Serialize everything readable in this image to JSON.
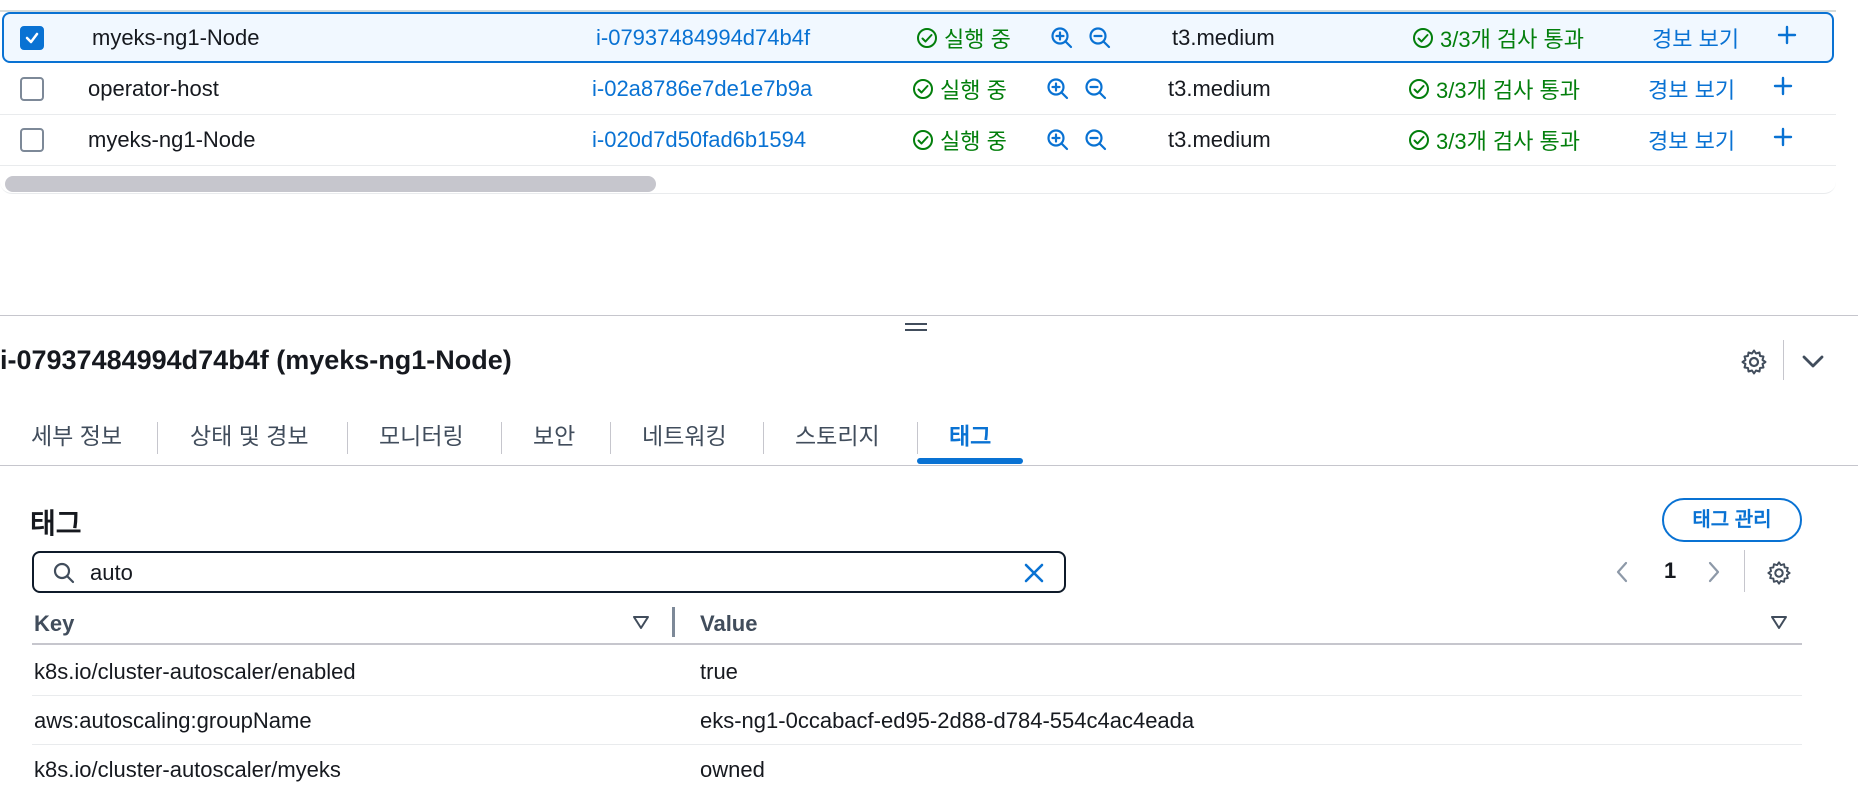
{
  "instances": [
    {
      "selected": true,
      "name": "myeks-ng1-Node",
      "id": "i-07937484994d74b4f",
      "state": "실행 중",
      "type": "t3.medium",
      "status_check": "3/3개 검사 통과",
      "alarm": "경보 보기",
      "add": "+"
    },
    {
      "selected": false,
      "name": "operator-host",
      "id": "i-02a8786e7de1e7b9a",
      "state": "실행 중",
      "type": "t3.medium",
      "status_check": "3/3개 검사 통과",
      "alarm": "경보 보기",
      "add": "+"
    },
    {
      "selected": false,
      "name": "myeks-ng1-Node",
      "id": "i-020d7d50fad6b1594",
      "state": "실행 중",
      "type": "t3.medium",
      "status_check": "3/3개 검사 통과",
      "alarm": "경보 보기",
      "add": "+"
    }
  ],
  "detail": {
    "title": "i-07937484994d74b4f (myeks-ng1-Node)"
  },
  "tabs": [
    {
      "label": "세부 정보",
      "active": false
    },
    {
      "label": "상태 및 경보",
      "active": false
    },
    {
      "label": "모니터링",
      "active": false
    },
    {
      "label": "보안",
      "active": false
    },
    {
      "label": "네트워킹",
      "active": false
    },
    {
      "label": "스토리지",
      "active": false
    },
    {
      "label": "태그",
      "active": true
    }
  ],
  "tags": {
    "title": "태그",
    "manage_button": "태그 관리",
    "search_value": "auto",
    "page": "1",
    "columns": {
      "key": "Key",
      "value": "Value"
    },
    "rows": [
      {
        "key": "k8s.io/cluster-autoscaler/enabled",
        "value": "true"
      },
      {
        "key": "aws:autoscaling:groupName",
        "value": "eks-ng1-0ccabacf-ed95-2d88-d784-554c4ac4eada"
      },
      {
        "key": "k8s.io/cluster-autoscaler/myeks",
        "value": "owned"
      }
    ]
  },
  "colors": {
    "link": "#0972d3",
    "success": "#037f0c",
    "text": "#16191f",
    "secondary_text": "#414d5c"
  }
}
